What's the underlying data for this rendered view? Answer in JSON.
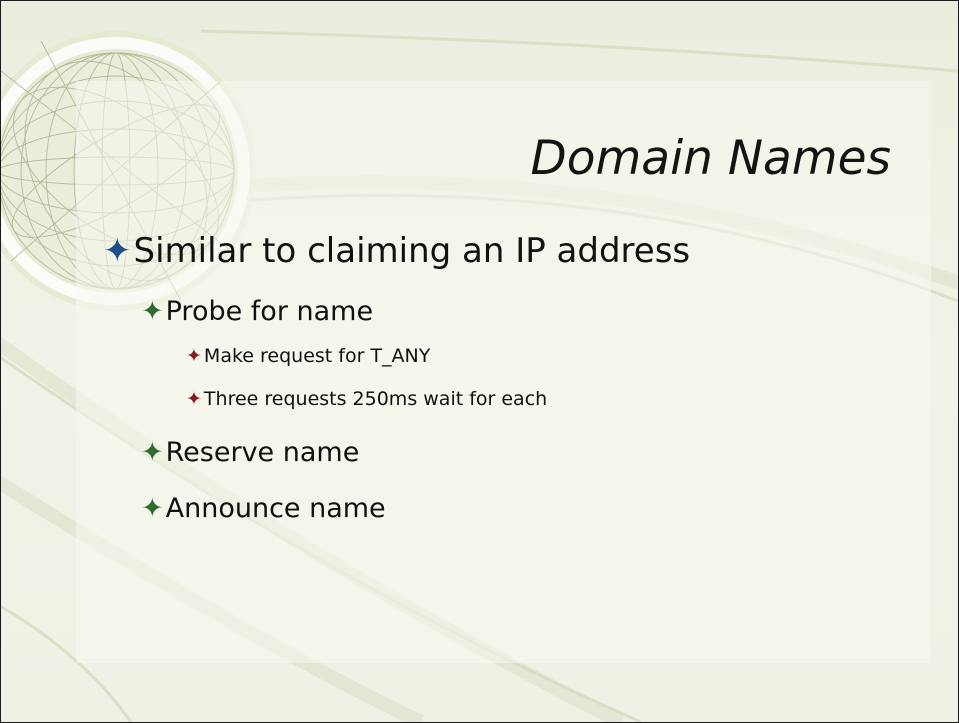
{
  "slide": {
    "title": "Domain Names",
    "bullets": [
      {
        "level": 1,
        "text": "Similar to claiming an IP address"
      },
      {
        "level": 2,
        "text": "Probe for name"
      },
      {
        "level": 3,
        "text": "Make request for T_ANY"
      },
      {
        "level": 3,
        "text": "Three requests 250ms wait for each"
      },
      {
        "level": 2,
        "text": "Reserve name"
      },
      {
        "level": 2,
        "text": "Announce name"
      }
    ],
    "bullet_glyph": "✦",
    "colors": {
      "background": "#edf1e3",
      "level1_bullet": "#1f4e8a",
      "level2_bullet": "#2e6b2e",
      "level3_bullet": "#8a1e1e",
      "text": "#111111"
    }
  }
}
